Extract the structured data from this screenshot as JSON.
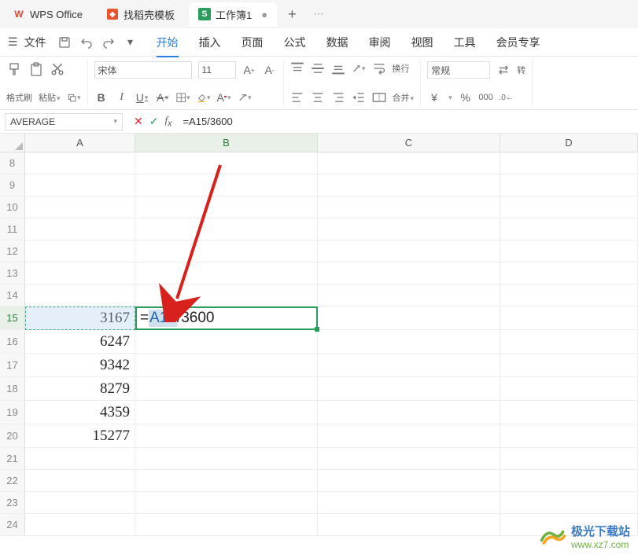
{
  "tabs": {
    "wps": "WPS Office",
    "template": "找稻壳模板",
    "workbook": "工作簿1",
    "modified_indicator": "●",
    "add": "+"
  },
  "menu": {
    "file": "文件",
    "items": [
      "开始",
      "插入",
      "页面",
      "公式",
      "数据",
      "审阅",
      "视图",
      "工具",
      "会员专享"
    ],
    "active_index": 0
  },
  "ribbon": {
    "format_brush": "格式刷",
    "paste": "粘贴",
    "font_name": "宋体",
    "font_size": "11",
    "wrap": "换行",
    "merge": "合并",
    "number_format": "常规",
    "convert": "转"
  },
  "formula_bar": {
    "name_box": "AVERAGE",
    "formula": "=A15/3600"
  },
  "grid": {
    "columns": [
      "A",
      "B",
      "C",
      "D"
    ],
    "first_row": 8,
    "active_row": 15,
    "active_col": "B",
    "ref_cell": "A15",
    "edit_parts": {
      "prefix": "=",
      "ref": "A15",
      "suffix": "/3600"
    },
    "data": {
      "A15": "3167",
      "A16": "6247",
      "A17": "9342",
      "A18": "8279",
      "A19": "4359",
      "A20": "15277"
    },
    "last_row": 24
  },
  "watermark": {
    "cn": "极光下载站",
    "url": "www.xz7.com"
  },
  "icons": {
    "currency": "¥",
    "percent": "%"
  }
}
